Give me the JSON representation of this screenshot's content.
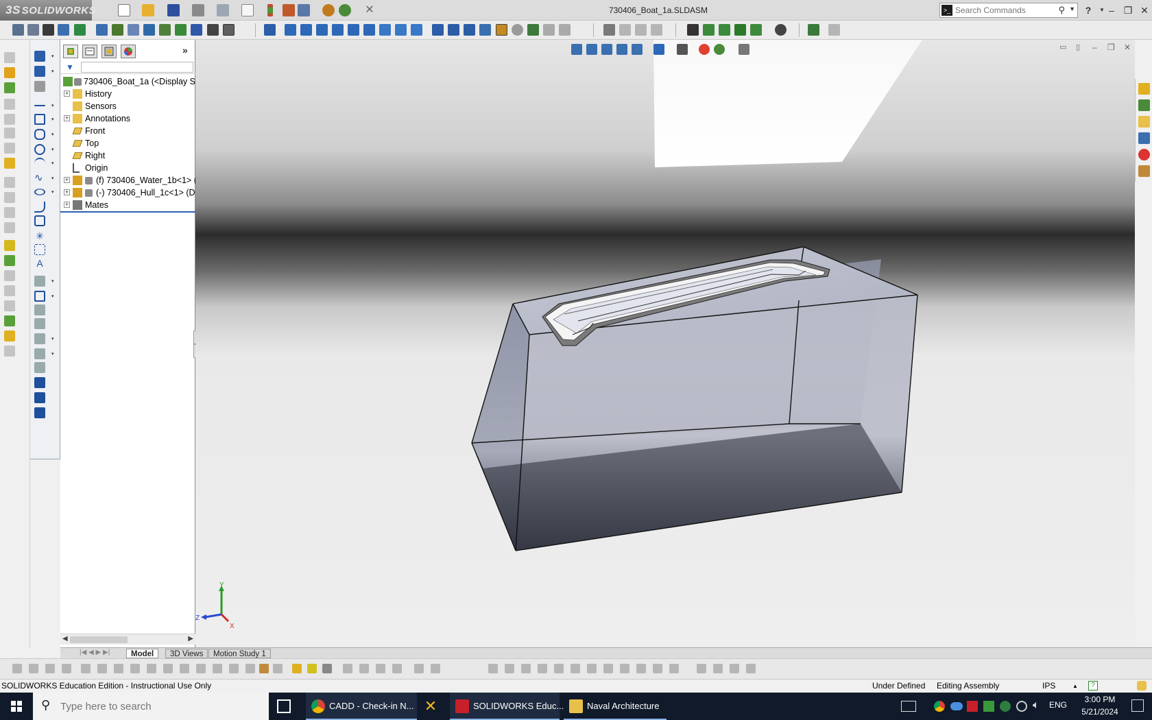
{
  "app": {
    "logo_text": "SOLIDWORKS",
    "logo_mark": "3S",
    "document_title": "730406_Boat_1a.SLDASM",
    "search_placeholder": "Search Commands",
    "help_label": "?",
    "window_buttons": [
      "–",
      "❐",
      "✕"
    ]
  },
  "feature_manager": {
    "filter_icon": "funnel-filter-icon",
    "tree": [
      {
        "label": "730406_Boat_1a  (<Display Sta",
        "icon": "assembly-icon",
        "expandable": false,
        "level": 0
      },
      {
        "label": "History",
        "icon": "history-folder-icon",
        "expandable": true,
        "level": 1
      },
      {
        "label": "Sensors",
        "icon": "sensors-folder-icon",
        "expandable": false,
        "level": 1
      },
      {
        "label": "Annotations",
        "icon": "annotations-icon",
        "expandable": true,
        "level": 1
      },
      {
        "label": "Front",
        "icon": "plane-icon",
        "expandable": false,
        "level": 1
      },
      {
        "label": "Top",
        "icon": "plane-icon",
        "expandable": false,
        "level": 1
      },
      {
        "label": "Right",
        "icon": "plane-icon",
        "expandable": false,
        "level": 1
      },
      {
        "label": "Origin",
        "icon": "origin-icon",
        "expandable": false,
        "level": 1
      },
      {
        "label": "(f) 730406_Water_1b<1> (I",
        "icon": "part-icon",
        "expandable": true,
        "level": 1
      },
      {
        "label": "(-) 730406_Hull_1c<1> (De",
        "icon": "part-icon",
        "expandable": true,
        "level": 1
      },
      {
        "label": "Mates",
        "icon": "mates-icon",
        "expandable": true,
        "level": 1
      }
    ]
  },
  "bottom_tabs": [
    "Model",
    "3D Views",
    "Motion Study 1"
  ],
  "active_bottom_tab": "Model",
  "status": {
    "edition": "SOLIDWORKS Education Edition - Instructional Use Only",
    "definition": "Under Defined",
    "mode": "Editing Assembly",
    "units": "IPS"
  },
  "triad": {
    "y": "Y",
    "z": "Z",
    "x": "X"
  },
  "taskbar": {
    "search_placeholder": "Type here to search",
    "apps": [
      {
        "label": "CADD - Check-in N...",
        "icon": "chrome-icon",
        "color": "#db4437"
      },
      {
        "label": "",
        "icon": "xodo-icon",
        "color": "#f2b61f"
      },
      {
        "label": "SOLIDWORKS Educ...",
        "icon": "solidworks-2015-icon",
        "color": "#c8202a"
      },
      {
        "label": "Naval Architecture",
        "icon": "folder-icon",
        "color": "#e8c04a"
      }
    ],
    "language": "ENG",
    "time": "3:00 PM",
    "date": "5/21/2024"
  },
  "colors": {
    "accent": "#2c5fb0",
    "taskbar": "#101a2a",
    "titlebar": "#dcdcdc"
  }
}
